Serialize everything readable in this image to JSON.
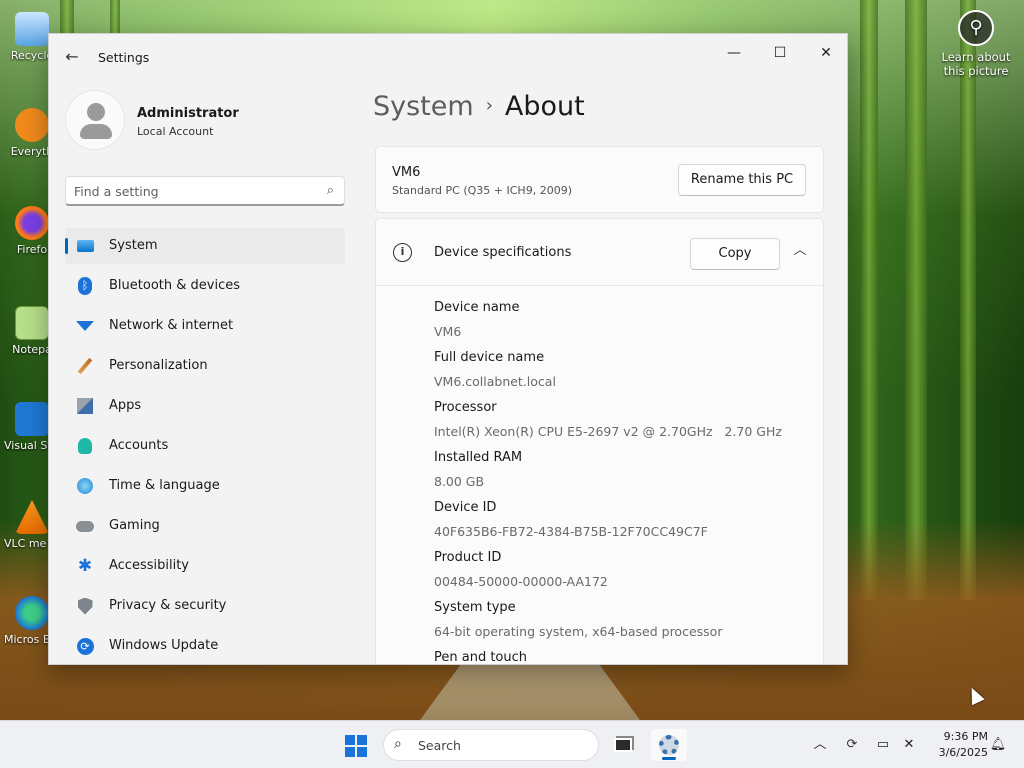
{
  "desktop": {
    "icons": [
      {
        "label": "Recycle"
      },
      {
        "label": "Everyth"
      },
      {
        "label": "Firefo"
      },
      {
        "label": "Notepa"
      },
      {
        "label": "Visual St Cod"
      },
      {
        "label": "VLC me playe"
      },
      {
        "label": "Micros Edge"
      }
    ],
    "learn_label": "Learn about this picture"
  },
  "window": {
    "app_title": "Settings",
    "controls": {
      "minimize": "—",
      "maximize": "☐",
      "close": "✕"
    }
  },
  "profile": {
    "name": "Administrator",
    "account_type": "Local Account"
  },
  "search": {
    "placeholder": "Find a setting"
  },
  "nav": {
    "items": [
      {
        "label": "System",
        "icon": "monitor-icon",
        "active": true
      },
      {
        "label": "Bluetooth & devices",
        "icon": "bluetooth-icon"
      },
      {
        "label": "Network & internet",
        "icon": "wifi-icon"
      },
      {
        "label": "Personalization",
        "icon": "brush-icon"
      },
      {
        "label": "Apps",
        "icon": "apps-icon"
      },
      {
        "label": "Accounts",
        "icon": "person-icon"
      },
      {
        "label": "Time & language",
        "icon": "globe-clock-icon"
      },
      {
        "label": "Gaming",
        "icon": "gamepad-icon"
      },
      {
        "label": "Accessibility",
        "icon": "accessibility-icon"
      },
      {
        "label": "Privacy & security",
        "icon": "shield-icon"
      },
      {
        "label": "Windows Update",
        "icon": "update-icon"
      }
    ]
  },
  "breadcrumb": {
    "parent": "System",
    "current": "About"
  },
  "pc": {
    "name": "VM6",
    "model": "Standard PC (Q35 + ICH9, 2009)",
    "rename_label": "Rename this PC"
  },
  "specs": {
    "title": "Device specifications",
    "copy_label": "Copy",
    "rows": [
      {
        "label": "Device name",
        "value": "VM6"
      },
      {
        "label": "Full device name",
        "value": "VM6.collabnet.local"
      },
      {
        "label": "Processor",
        "value": "Intel(R) Xeon(R) CPU E5-2697 v2 @ 2.70GHz   2.70 GHz"
      },
      {
        "label": "Installed RAM",
        "value": "8.00 GB"
      },
      {
        "label": "Device ID",
        "value": "40F635B6-FB72-4384-B75B-12F70CC49C7F"
      },
      {
        "label": "Product ID",
        "value": "00484-50000-00000-AA172"
      },
      {
        "label": "System type",
        "value": "64-bit operating system, x64-based processor"
      },
      {
        "label": "Pen and touch",
        "value": ""
      }
    ]
  },
  "taskbar": {
    "search_label": "Search",
    "time": "9:36 PM",
    "date": "3/6/2025"
  },
  "colors": {
    "accent": "#0067c0",
    "window_bg": "#f3f3f3",
    "card_bg": "#fbfbfb"
  }
}
